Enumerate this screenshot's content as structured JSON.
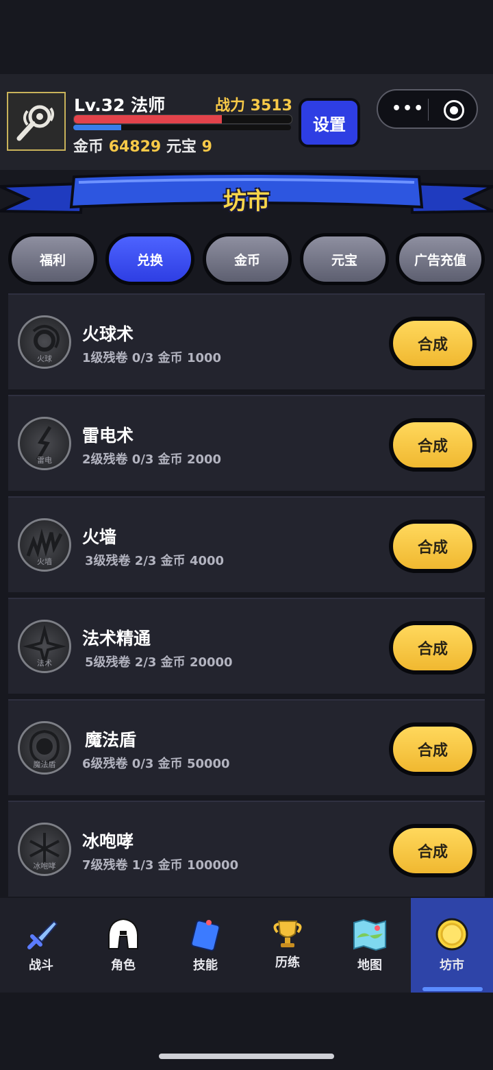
{
  "header": {
    "level_text": "Lv.32 法师",
    "power_text": "战力 3513",
    "hp_fraction": 0.68,
    "mp_fraction": 0.22,
    "gold_label": "金币",
    "gold_value": "64829",
    "yuanbao_label": "元宝",
    "yuanbao_value": "9",
    "settings_label": "设置"
  },
  "banner": {
    "title": "坊市"
  },
  "tabs": [
    {
      "label": "福利"
    },
    {
      "label": "兑换"
    },
    {
      "label": "金币"
    },
    {
      "label": "元宝"
    },
    {
      "label": "广告充值"
    }
  ],
  "items": [
    {
      "name": "火球术",
      "desc": "1级残卷 0/3  金币 1000",
      "icon": "fireball-icon",
      "icon_caption": "火球",
      "button": "合成"
    },
    {
      "name": "雷电术",
      "desc": "2级残卷 0/3  金币 2000",
      "icon": "lightning-icon",
      "icon_caption": "雷电",
      "button": "合成"
    },
    {
      "name": "火墙",
      "desc": "3级残卷 2/3  金币 4000",
      "icon": "firewall-icon",
      "icon_caption": "火墙",
      "button": "合成"
    },
    {
      "name": "法术精通",
      "desc": "5级残卷 2/3  金币 20000",
      "icon": "mastery-icon",
      "icon_caption": "法术",
      "button": "合成"
    },
    {
      "name": "魔法盾",
      "desc": "6级残卷 0/3  金币 50000",
      "icon": "shield-icon",
      "icon_caption": "魔法盾",
      "button": "合成"
    },
    {
      "name": "冰咆哮",
      "desc": "7级残卷 1/3  金币 100000",
      "icon": "ice-icon",
      "icon_caption": "冰咆哮",
      "button": "合成"
    }
  ],
  "nav": [
    {
      "label": "战斗",
      "icon": "sword-icon"
    },
    {
      "label": "角色",
      "icon": "helmet-icon"
    },
    {
      "label": "技能",
      "icon": "spellbook-icon"
    },
    {
      "label": "历练",
      "icon": "trophy-icon"
    },
    {
      "label": "地图",
      "icon": "map-icon"
    },
    {
      "label": "坊市",
      "icon": "coin-icon",
      "active": true
    }
  ]
}
